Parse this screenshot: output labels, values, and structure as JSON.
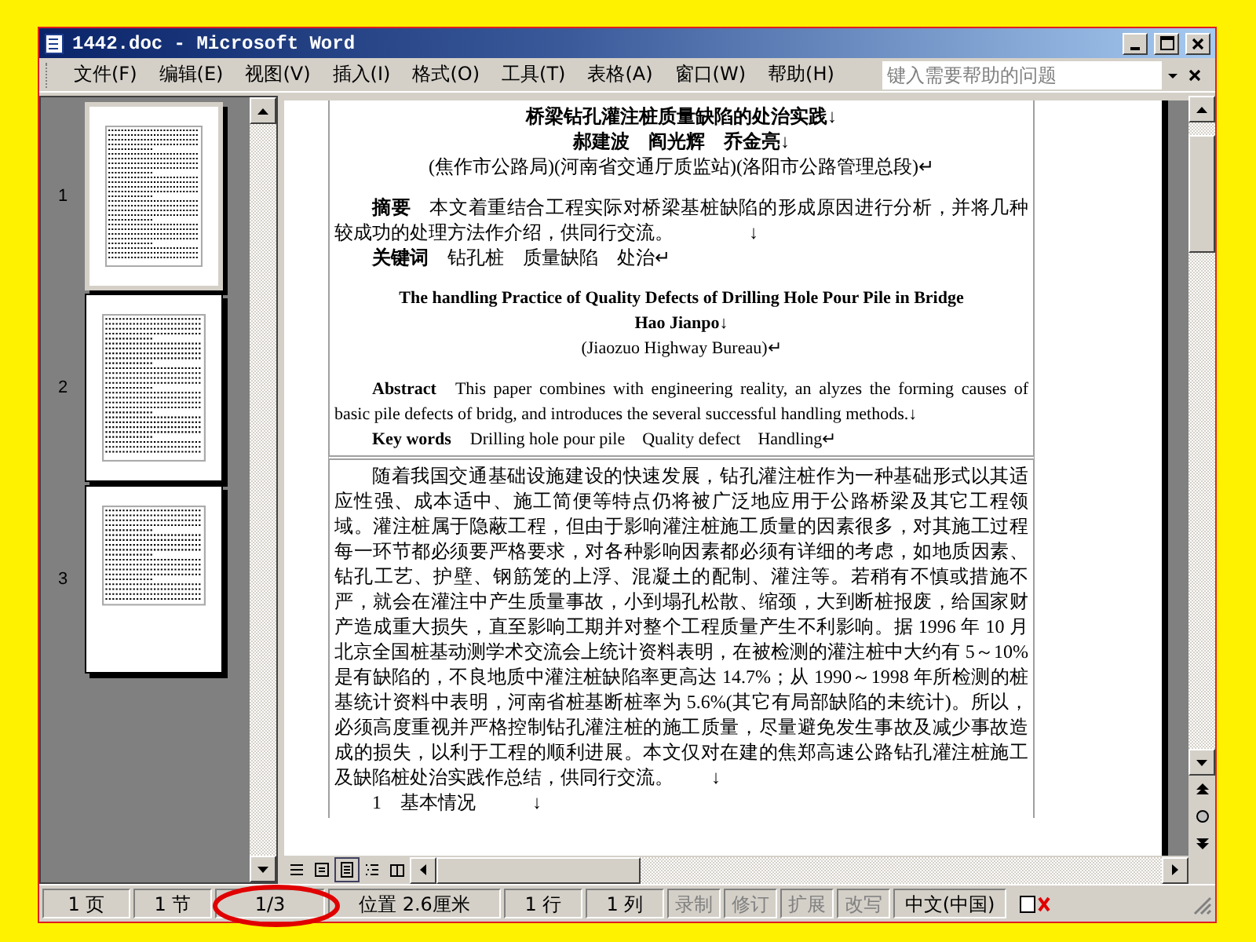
{
  "window": {
    "title": "1442.doc - Microsoft Word"
  },
  "menu": [
    "文件(F)",
    "编辑(E)",
    "视图(V)",
    "插入(I)",
    "格式(O)",
    "工具(T)",
    "表格(A)",
    "窗口(W)",
    "帮助(H)"
  ],
  "help_box": {
    "placeholder": "键入需要帮助的问题"
  },
  "thumbnails": [
    {
      "label": "1",
      "selected": true
    },
    {
      "label": "2",
      "selected": false
    },
    {
      "label": "3",
      "selected": false
    }
  ],
  "document": {
    "header": [
      {
        "kind": "title",
        "text": "桥梁钻孔灌注桩质量缺陷的处治实践↓"
      },
      {
        "kind": "authors",
        "text": "郝建波　阎光辉　乔金亮↓"
      },
      {
        "kind": "center",
        "text": "(焦作市公路局)(河南省交通厅质监站)(洛阳市公路管理总段)↵"
      },
      {
        "kind": "gap"
      },
      {
        "kind": "labeled",
        "label": "摘要",
        "text": "本文着重结合工程实际对桥梁基桩缺陷的形成原因进行分析，并将几种较成功的处理方法作介绍，供同行交流。　　　　↓"
      },
      {
        "kind": "labeled",
        "label": "关键词",
        "text": "钻孔桩　质量缺陷　处治↵"
      },
      {
        "kind": "gap"
      },
      {
        "kind": "en_title",
        "text": "The handling Practice of Quality Defects of Drilling Hole Pour Pile in Bridge"
      },
      {
        "kind": "en_title",
        "text": "Hao Jianpo↓"
      },
      {
        "kind": "en_center",
        "text": "(Jiaozuo Highway Bureau)↵"
      },
      {
        "kind": "gap"
      },
      {
        "kind": "en_labeled",
        "label": "Abstract",
        "text": "This paper combines with engineering reality, an alyzes the forming causes of basic pile defects of bridg, and introduces the several successful handling methods.↓"
      },
      {
        "kind": "en_labeled",
        "label": "Key words",
        "text": "Drilling hole pour pile　Quality defect　Handling↵"
      }
    ],
    "body": [
      {
        "kind": "para",
        "text": "随着我国交通基础设施建设的快速发展，钻孔灌注桩作为一种基础形式以其适应性强、成本适中、施工简便等特点仍将被广泛地应用于公路桥梁及其它工程领域。灌注桩属于隐蔽工程，但由于影响灌注桩施工质量的因素很多，对其施工过程每一环节都必须要严格要求，对各种影响因素都必须有详细的考虑，如地质因素、钻孔工艺、护壁、钢筋笼的上浮、混凝土的配制、灌注等。若稍有不慎或措施不严，就会在灌注中产生质量事故，小到塌孔松散、缩颈，大到断桩报废，给国家财产造成重大损失，直至影响工期并对整个工程质量产生不利影响。据 1996 年 10 月北京全国桩基动测学术交流会上统计资料表明，在被检测的灌注桩中大约有 5～10% 是有缺陷的，不良地质中灌注桩缺陷率更高达 14.7%；从 1990～1998 年所检测的桩基统计资料中表明，河南省桩基断桩率为 5.6%(其它有局部缺陷的未统计)。所以，必须高度重视并严格控制钻孔灌注桩的施工质量，尽量避免发生事故及减少事故造成的损失，以利于工程的顺利进展。本文仅对在建的焦郑高速公路钻孔灌注桩施工及缺陷桩处治实践作总结，供同行交流。　　↓"
      },
      {
        "kind": "heading",
        "text": "1　基本情况　　　↓"
      }
    ]
  },
  "view_buttons": [
    {
      "kind": "normal",
      "selected": false
    },
    {
      "kind": "web",
      "selected": false
    },
    {
      "kind": "print",
      "selected": true
    },
    {
      "kind": "outline",
      "selected": false
    },
    {
      "kind": "reading",
      "selected": false
    }
  ],
  "status_bar": [
    {
      "text": "1 页",
      "disabled": false
    },
    {
      "text": "1 节",
      "disabled": false
    },
    {
      "text": "1/3",
      "disabled": false
    },
    {
      "text": "位置 2.6厘米",
      "disabled": false
    },
    {
      "text": "1 行",
      "disabled": false
    },
    {
      "text": "1 列",
      "disabled": false
    },
    {
      "text": "录制",
      "disabled": true
    },
    {
      "text": "修订",
      "disabled": true
    },
    {
      "text": "扩展",
      "disabled": true
    },
    {
      "text": "改写",
      "disabled": true
    },
    {
      "text": "中文(中国)",
      "disabled": false
    }
  ]
}
